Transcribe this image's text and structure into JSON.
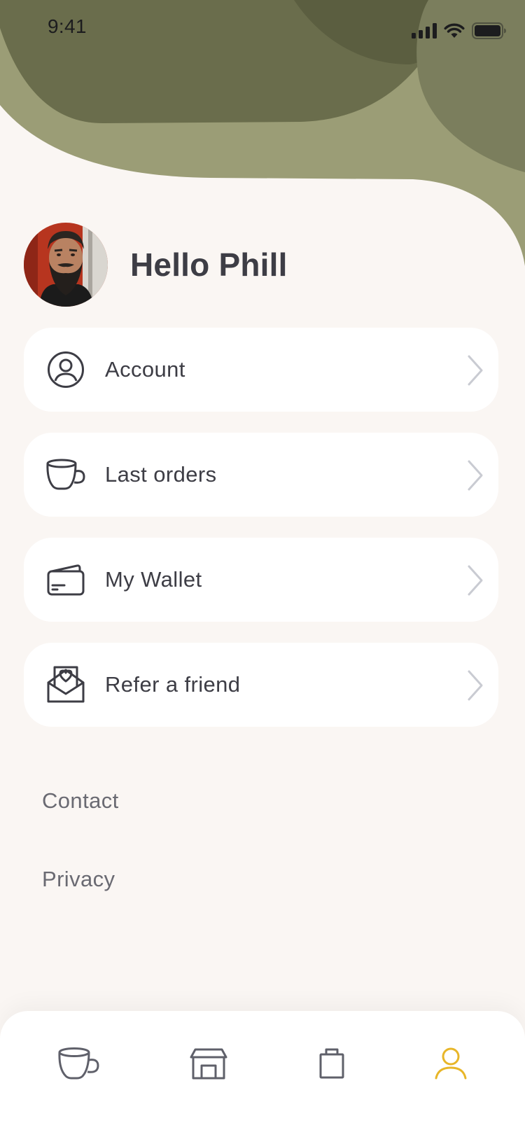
{
  "status_bar": {
    "time": "9:41"
  },
  "profile": {
    "greeting": "Hello Phill"
  },
  "menu": {
    "items": [
      {
        "label": "Account",
        "icon": "user-circle-icon"
      },
      {
        "label": "Last orders",
        "icon": "cup-icon"
      },
      {
        "label": "My Wallet",
        "icon": "wallet-icon"
      },
      {
        "label": "Refer a friend",
        "icon": "envelope-heart-icon"
      }
    ]
  },
  "links": {
    "contact": "Contact",
    "privacy": "Privacy"
  },
  "tabbar": {
    "active_index": 3,
    "tabs": [
      {
        "icon": "cup-icon"
      },
      {
        "icon": "store-icon"
      },
      {
        "icon": "shopping-bag-icon"
      },
      {
        "icon": "user-icon"
      }
    ]
  },
  "colors": {
    "background": "#faf6f3",
    "header_dark": "#6a6d4c",
    "header_light": "#9b9d76",
    "text": "#3d3d45",
    "active_tab": "#e8b629",
    "chevron": "#c9cbd2"
  }
}
